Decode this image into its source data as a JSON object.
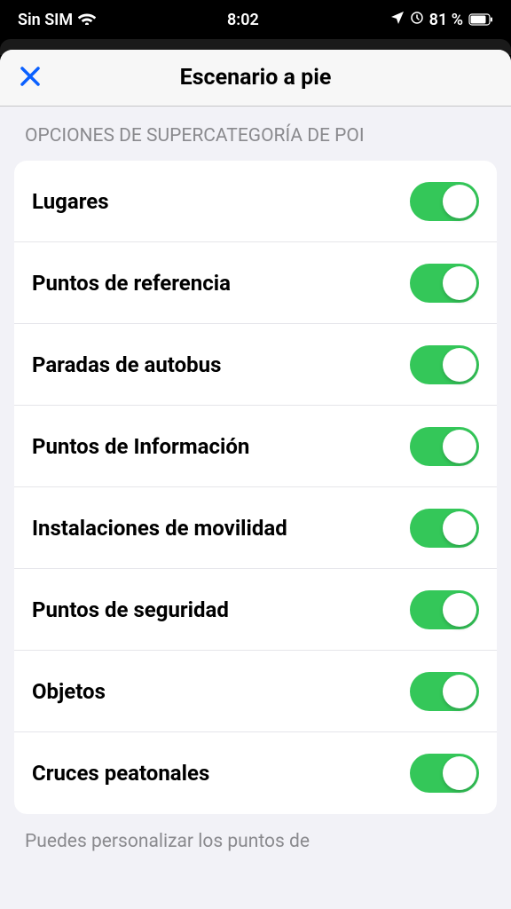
{
  "statusBar": {
    "carrier": "Sin SIM",
    "time": "8:02",
    "batteryPercent": "81 %"
  },
  "nav": {
    "title": "Escenario a pie"
  },
  "section": {
    "header": "OPCIONES DE SUPERCATEGORÍA DE POI"
  },
  "rows": [
    {
      "label": "Lugares",
      "on": true
    },
    {
      "label": "Puntos de referencia",
      "on": true
    },
    {
      "label": "Paradas de autobus",
      "on": true
    },
    {
      "label": "Puntos de Información",
      "on": true
    },
    {
      "label": "Instalaciones de movilidad",
      "on": true
    },
    {
      "label": "Puntos de seguridad",
      "on": true
    },
    {
      "label": "Objetos",
      "on": true
    },
    {
      "label": "Cruces peatonales",
      "on": true
    }
  ],
  "footerText": "Puedes personalizar los puntos de"
}
